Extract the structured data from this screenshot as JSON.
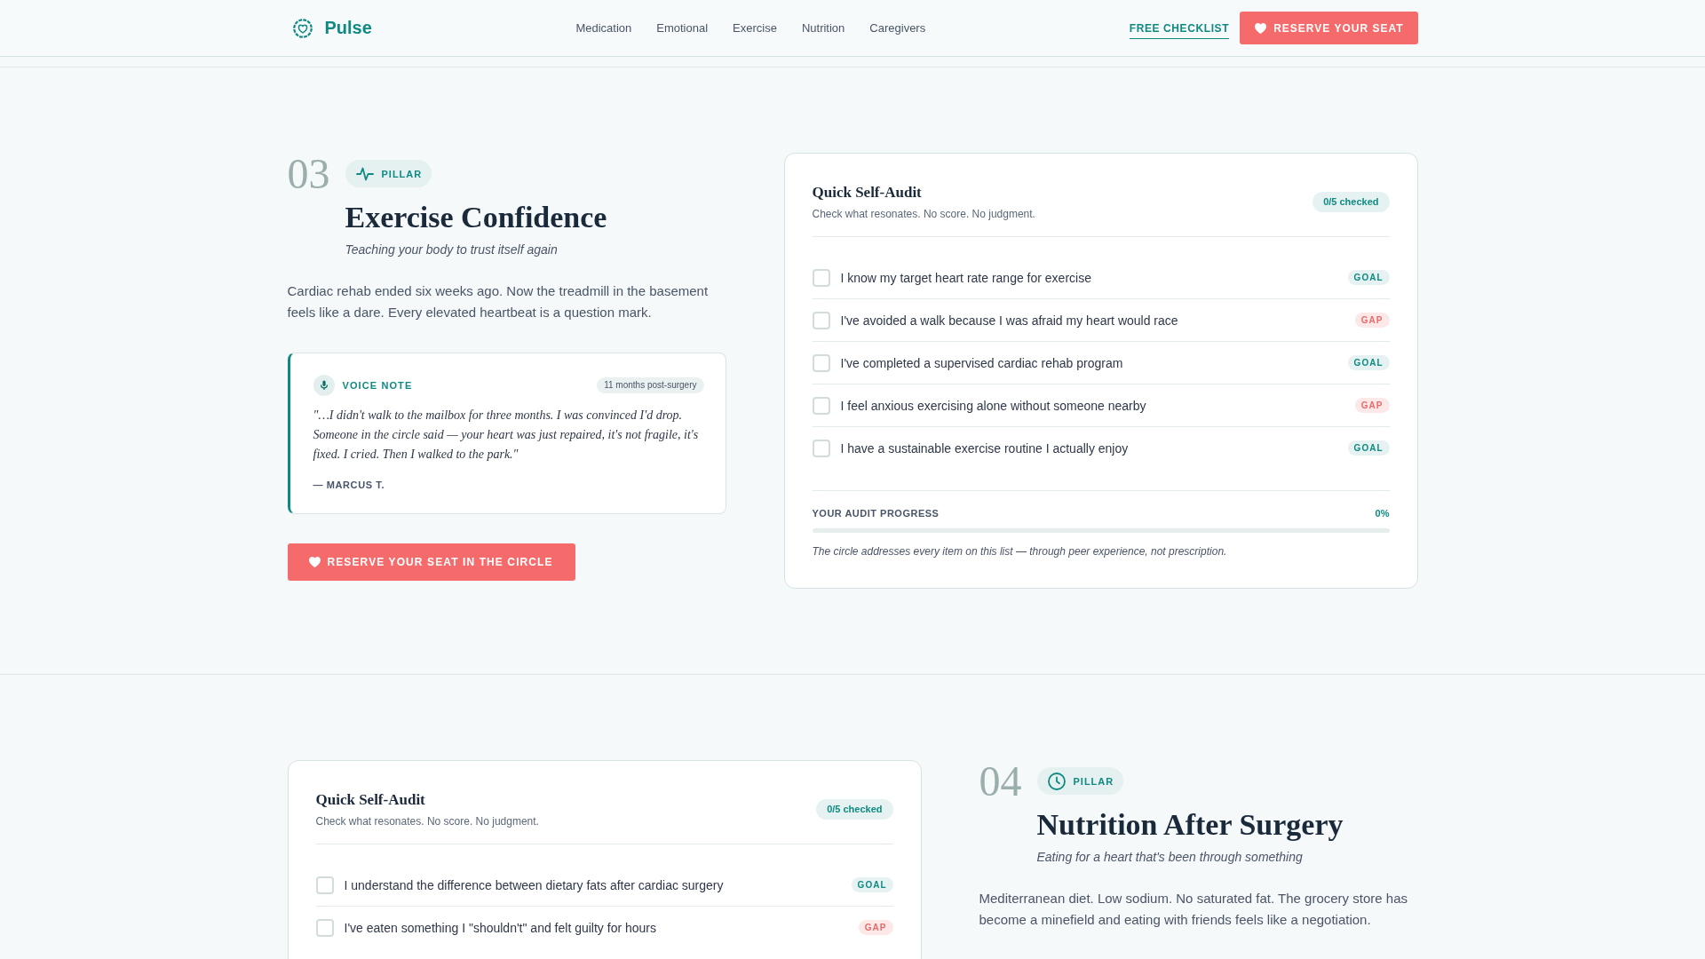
{
  "header": {
    "brand": "Pulse",
    "nav": [
      "Medication",
      "Emotional",
      "Exercise",
      "Nutrition",
      "Caregivers"
    ],
    "link": "FREE CHECKLIST",
    "button": "RESERVE YOUR SEAT"
  },
  "sections": [
    {
      "reversed": false,
      "number": "03",
      "badge": {
        "label": "PILLAR"
      },
      "title": "Exercise Confidence",
      "subtitle": "Teaching your body to trust itself again",
      "body": "Cardiac rehab ended six weeks ago. Now the treadmill in the basement feels like a dare. Every elevated heartbeat is a question mark.",
      "voice_note": {
        "label": "VOICE NOTE",
        "tag": "11 months post-surgery",
        "quote": "\"…I didn't walk to the mailbox for three months. I was convinced I'd drop. Someone in the circle said — your heart was just repaired, it's not fragile, it's fixed. I cried. Then I walked to the park.\"",
        "author": "— MARCUS T."
      },
      "button": "RESERVE YOUR SEAT IN THE CIRCLE",
      "audit": {
        "title": "Quick Self-Audit",
        "subtitle": "Check what resonates. No score. No judgment.",
        "count": "0/5 checked",
        "items": [
          {
            "text": "I know my target heart rate range for exercise",
            "checked": false,
            "kind": "goal",
            "tag": "GOAL"
          },
          {
            "text": "I've avoided a walk because I was afraid my heart would race",
            "checked": false,
            "kind": "gap",
            "tag": "GAP"
          },
          {
            "text": "I've completed a supervised cardiac rehab program",
            "checked": false,
            "kind": "goal",
            "tag": "GOAL"
          },
          {
            "text": "I feel anxious exercising alone without someone nearby",
            "checked": false,
            "kind": "gap",
            "tag": "GAP"
          },
          {
            "text": "I have a sustainable exercise routine I actually enjoy",
            "checked": false,
            "kind": "goal",
            "tag": "GOAL"
          }
        ],
        "progress": {
          "label": "YOUR AUDIT PROGRESS",
          "reading": "0%",
          "level": 0
        },
        "note": "The circle addresses every item on this list — through peer experience, not prescription."
      }
    },
    {
      "reversed": true,
      "number": "04",
      "badge": {
        "label": "PILLAR"
      },
      "title": "Nutrition After Surgery",
      "subtitle": "Eating for a heart that's been through something",
      "body": "Mediterranean diet. Low sodium. No saturated fat. The grocery store has become a minefield and eating with friends feels like a negotiation.",
      "audit": {
        "title": "Quick Self-Audit",
        "subtitle": "Check what resonates. No score. No judgment.",
        "count": "0/5 checked",
        "items": [
          {
            "text": "I understand the difference between dietary fats after cardiac surgery",
            "checked": false,
            "kind": "goal",
            "tag": "GOAL"
          },
          {
            "text": "I've eaten something I \"shouldn't\" and felt guilty for hours",
            "checked": false,
            "kind": "gap",
            "tag": "GAP"
          }
        ]
      }
    }
  ]
}
